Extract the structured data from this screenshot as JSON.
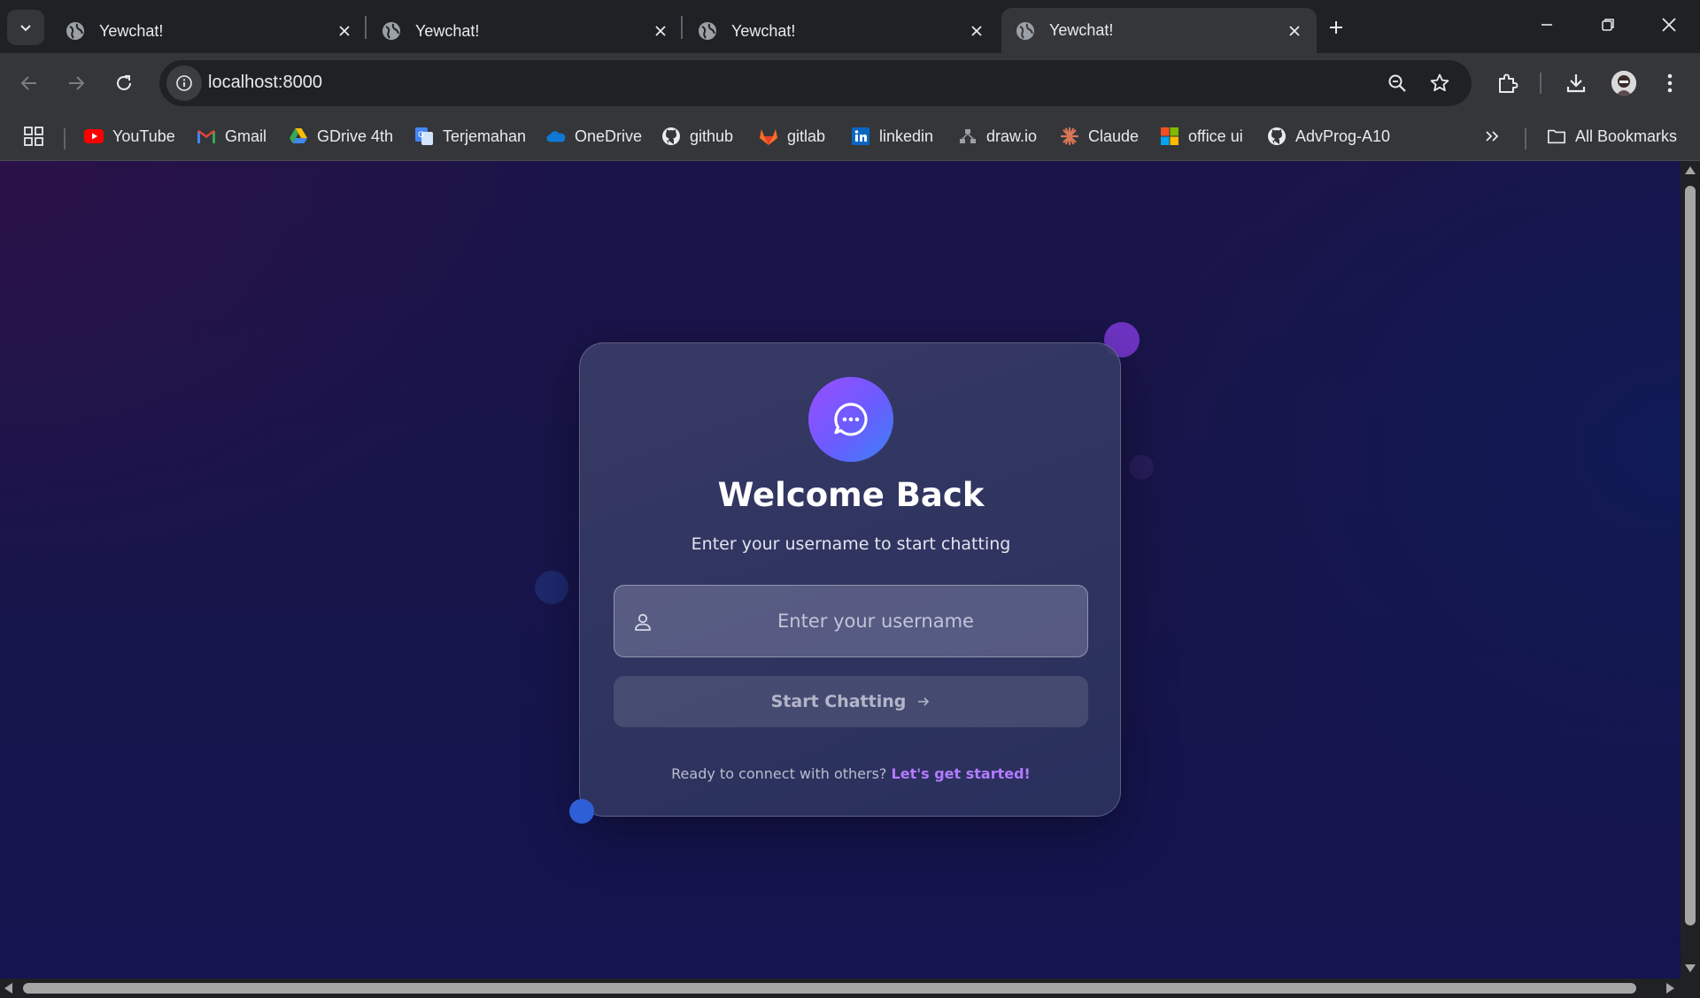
{
  "browser": {
    "tabs": [
      {
        "title": "Yewchat!",
        "active": false
      },
      {
        "title": "Yewchat!",
        "active": false
      },
      {
        "title": "Yewchat!",
        "active": false
      },
      {
        "title": "Yewchat!",
        "active": true
      }
    ],
    "url": "localhost:8000",
    "bookmarks": [
      {
        "label": "YouTube",
        "icon": "youtube-icon"
      },
      {
        "label": "Gmail",
        "icon": "gmail-icon"
      },
      {
        "label": "GDrive 4th",
        "icon": "gdrive-icon"
      },
      {
        "label": "Terjemahan",
        "icon": "translate-icon"
      },
      {
        "label": "OneDrive",
        "icon": "onedrive-icon"
      },
      {
        "label": "github",
        "icon": "github-icon"
      },
      {
        "label": "gitlab",
        "icon": "gitlab-icon"
      },
      {
        "label": "linkedin",
        "icon": "linkedin-icon"
      },
      {
        "label": "draw.io",
        "icon": "drawio-icon"
      },
      {
        "label": "Claude",
        "icon": "claude-icon"
      },
      {
        "label": "office ui",
        "icon": "office-icon"
      },
      {
        "label": "AdvProg-A10",
        "icon": "github-icon"
      }
    ],
    "all_bookmarks_label": "All Bookmarks"
  },
  "login": {
    "title": "Welcome Back",
    "subtitle": "Enter your username to start chatting",
    "username_placeholder": "Enter your username",
    "username_value": "",
    "button_label": "Start Chatting",
    "footer_text": "Ready to connect with others?",
    "footer_link": "Let's get started!"
  },
  "colors": {
    "accent_purple": "#9b4dff",
    "accent_blue": "#3b82f6",
    "link": "#b37bff"
  }
}
